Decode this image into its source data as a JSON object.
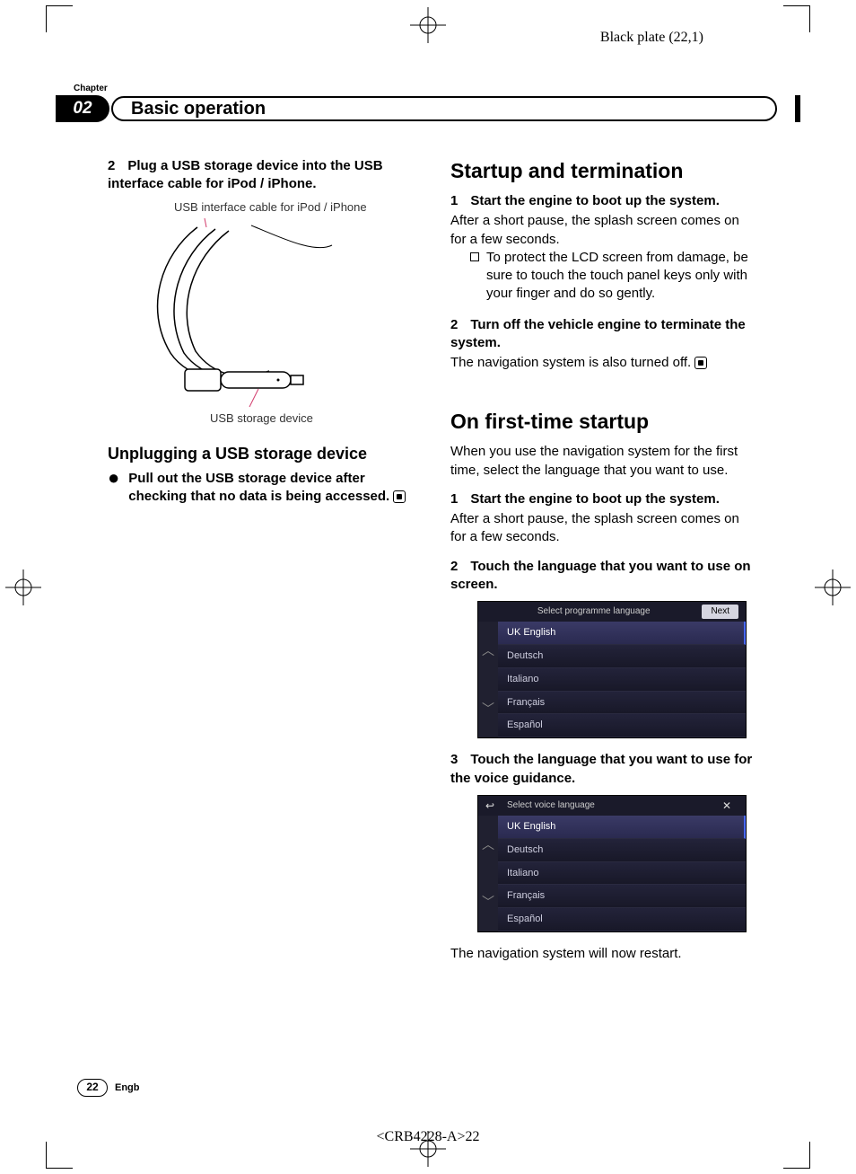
{
  "meta": {
    "black_plate": "Black plate (22,1)",
    "chapter_label": "Chapter",
    "chapter_num": "02",
    "chapter_title": "Basic operation",
    "page_num": "22",
    "lang_code": "Engb",
    "doc_code": "<CRB4228-A>22"
  },
  "left": {
    "step2_num": "2",
    "step2_text": "Plug a USB storage device into the USB interface cable for iPod / iPhone.",
    "fig_top": "USB interface cable for iPod / iPhone",
    "fig_bot": "USB storage device",
    "sub_h": "Unplugging a USB storage device",
    "bullet": "Pull out the USB storage device after checking that no data is being accessed."
  },
  "right": {
    "h1": "Startup and termination",
    "s1_num": "1",
    "s1_text": "Start the engine to boot up the system.",
    "s1_body": "After a short pause, the splash screen comes on for a few seconds.",
    "s1_note": "To protect the LCD screen from damage, be sure to touch the touch panel keys only with your finger and do so gently.",
    "s2_num": "2",
    "s2_text": "Turn off the vehicle engine to terminate the system.",
    "s2_body": "The navigation system is also turned off.",
    "h2": "On first-time startup",
    "h2_intro": "When you use the navigation system for the first time, select the language that you want to use.",
    "f1_num": "1",
    "f1_text": "Start the engine to boot up the system.",
    "f1_body": "After a short pause, the splash screen comes on for a few seconds.",
    "f2_num": "2",
    "f2_text": "Touch the language that you want to use on screen.",
    "f3_num": "3",
    "f3_text": "Touch the language that you want to use for the voice guidance.",
    "restart": "The navigation system will now restart."
  },
  "screen1": {
    "title": "Select programme language",
    "next": "Next",
    "langs": [
      "UK English",
      "Deutsch",
      "Italiano",
      "Français",
      "Español"
    ]
  },
  "screen2": {
    "title": "Select voice language",
    "langs": [
      "UK English",
      "Deutsch",
      "Italiano",
      "Français",
      "Español"
    ]
  }
}
